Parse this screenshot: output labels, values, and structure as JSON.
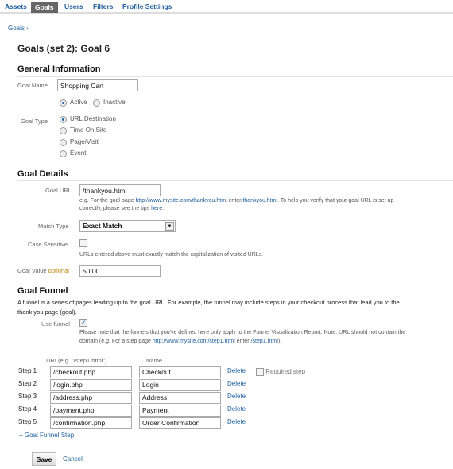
{
  "tabs": [
    {
      "label": "Assets"
    },
    {
      "label": "Goals",
      "active": true
    },
    {
      "label": "Users"
    },
    {
      "label": "Filters"
    },
    {
      "label": "Profile Settings"
    }
  ],
  "breadcrumb": "Goals ›",
  "title": "Goals (set 2): Goal 6",
  "general": {
    "heading": "General Information",
    "goal_name_label": "Goal Name",
    "goal_name": "Shopping Cart",
    "status": [
      {
        "label": "Active",
        "checked": true
      },
      {
        "label": "Inactive",
        "checked": false
      }
    ],
    "goal_type_label": "Goal Type",
    "goal_types": [
      {
        "label": "URL Destination",
        "checked": true
      },
      {
        "label": "Time On Site",
        "checked": false
      },
      {
        "label": "Page/Visit",
        "checked": false
      },
      {
        "label": "Event",
        "checked": false
      }
    ]
  },
  "details": {
    "heading": "Goal Details",
    "goal_url_label": "Goal URL",
    "goal_url": "/thankyou.html",
    "help_1a": "e.g. For the goal page ",
    "help_1_link": "http://www.mysite.com/thankyou.html",
    "help_1b": " enter",
    "help_1_link2": "/thankyou.html",
    "help_1c": ". To help you verify that your goal URL is set up",
    "help_2a": "correctly, please see the tips ",
    "help_2_link": "here",
    "help_2b": ".",
    "match_type_label": "Match Type",
    "match_type": "Exact Match",
    "case_label": "Case Sensitive",
    "case_checked": false,
    "case_help": "URLs entered above must exactly match the capitalization of visited URLs.",
    "value_label": "Goal Value",
    "value_optional": "optional",
    "value": "50.00"
  },
  "funnel": {
    "heading": "Goal Funnel",
    "desc_1": "A funnel is a series of pages leading up to the goal URL. For example, the funnel may include steps in your checkout process that lead you to the",
    "desc_2": "thank you page (goal).",
    "use_label": "Use funnel",
    "use_checked": true,
    "note_1": "Please note that the funnels that you've defined here only apply to the Funnel Visualization Report. Note: URL should not contain the",
    "note_2a": "domain (e.g. For a step page ",
    "note_2_link": "http://www.mysite.com/step1.html",
    "note_2b": " enter ",
    "note_2_link2": "/step1.html",
    "note_2c": ").",
    "url_header": "URL(e.g. \"/step1.html\")",
    "name_header": "Name",
    "steps": [
      {
        "label": "Step 1",
        "url": "/checkout.php",
        "name": "Checkout"
      },
      {
        "label": "Step 2",
        "url": "/login.php",
        "name": "Login"
      },
      {
        "label": "Step 3",
        "url": "/address.php",
        "name": "Address"
      },
      {
        "label": "Step 4",
        "url": "/payment.php",
        "name": "Payment"
      },
      {
        "label": "Step 5",
        "url": "/confirmation.php",
        "name": "Order Confirmation"
      }
    ],
    "delete_label": "Delete",
    "required_label": "Required step",
    "required_checked": false,
    "add_step": "+ Goal Funnel Step"
  },
  "actions": {
    "save": "Save",
    "cancel": "Cancel"
  }
}
